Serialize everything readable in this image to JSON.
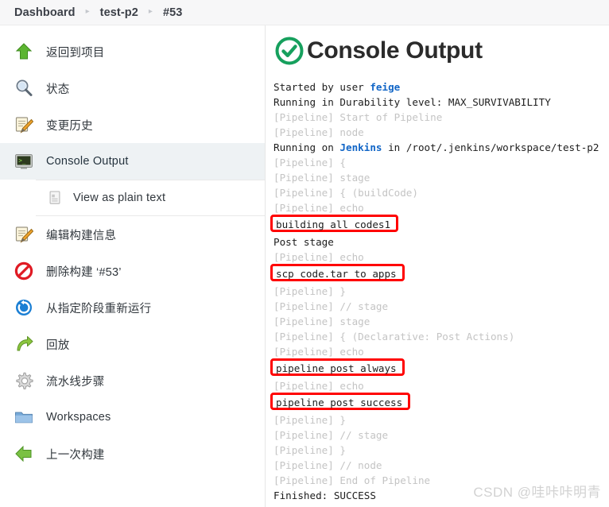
{
  "breadcrumb": {
    "items": [
      {
        "label": "Dashboard",
        "name": "breadcrumb-dashboard"
      },
      {
        "label": "test-p2",
        "name": "breadcrumb-test-p2"
      },
      {
        "label": "#53",
        "name": "breadcrumb-build-53"
      }
    ],
    "separator": "▸"
  },
  "sidebar": {
    "items": [
      {
        "label": "返回到项目",
        "icon": "up-arrow-green-icon",
        "name": "sidebar-item-back-to-project",
        "active": false
      },
      {
        "label": "状态",
        "icon": "magnifier-icon",
        "name": "sidebar-item-status",
        "active": false
      },
      {
        "label": "变更历史",
        "icon": "notepad-pencil-icon",
        "name": "sidebar-item-changes",
        "active": false
      },
      {
        "label": "Console Output",
        "icon": "terminal-icon",
        "name": "sidebar-item-console-output",
        "active": true
      }
    ],
    "sub_item": {
      "label": "View as plain text",
      "icon": "plain-text-icon",
      "name": "sidebar-subitem-view-as-plain-text"
    },
    "items2": [
      {
        "label": "编辑构建信息",
        "icon": "notepad-pencil-icon",
        "name": "sidebar-item-edit-build-information",
        "active": false
      },
      {
        "label": "删除构建 ‘#53’",
        "icon": "no-entry-icon",
        "name": "sidebar-item-delete-build",
        "active": false
      },
      {
        "label": "从指定阶段重新运行",
        "icon": "restart-circle-icon",
        "name": "sidebar-item-restart-from-stage",
        "active": false
      },
      {
        "label": "回放",
        "icon": "replay-arrow-icon",
        "name": "sidebar-item-replay",
        "active": false
      },
      {
        "label": "流水线步骤",
        "icon": "gear-icon",
        "name": "sidebar-item-pipeline-steps",
        "active": false
      },
      {
        "label": "Workspaces",
        "icon": "folder-icon",
        "name": "sidebar-item-workspaces",
        "active": false
      },
      {
        "label": "上一次构建",
        "icon": "left-arrow-green-icon",
        "name": "sidebar-item-previous-build",
        "active": false
      }
    ]
  },
  "console": {
    "title": "Console Output",
    "status_icon": "success-check-circle-icon",
    "status_color": "#16a05d",
    "annotation_color": "#ff0000",
    "pipeline_prefix": "[Pipeline]",
    "lines": [
      {
        "type": "mixed",
        "parts": [
          {
            "t": "Started by user ",
            "s": "plain"
          },
          {
            "t": "feige",
            "s": "link"
          }
        ]
      },
      {
        "type": "plain",
        "text": "Running in Durability level: MAX_SURVIVABILITY"
      },
      {
        "type": "pipeline",
        "text": "[Pipeline] Start of Pipeline"
      },
      {
        "type": "pipeline",
        "text": "[Pipeline] node"
      },
      {
        "type": "mixed",
        "parts": [
          {
            "t": "Running on ",
            "s": "plain"
          },
          {
            "t": "Jenkins",
            "s": "link"
          },
          {
            "t": " in /root/.jenkins/workspace/test-p2",
            "s": "plain"
          }
        ]
      },
      {
        "type": "pipeline",
        "text": "[Pipeline] {"
      },
      {
        "type": "pipeline",
        "text": "[Pipeline] stage"
      },
      {
        "type": "pipeline",
        "text": "[Pipeline] { (buildCode)"
      },
      {
        "type": "pipeline",
        "text": "[Pipeline] echo"
      },
      {
        "type": "boxed",
        "text": "building all codes1"
      },
      {
        "type": "plain",
        "text": "Post stage"
      },
      {
        "type": "pipeline",
        "text": "[Pipeline] echo"
      },
      {
        "type": "boxed",
        "text": "scp code.tar to apps"
      },
      {
        "type": "pipeline",
        "text": "[Pipeline] }"
      },
      {
        "type": "pipeline",
        "text": "[Pipeline] // stage"
      },
      {
        "type": "pipeline",
        "text": "[Pipeline] stage"
      },
      {
        "type": "pipeline",
        "text": "[Pipeline] { (Declarative: Post Actions)"
      },
      {
        "type": "pipeline",
        "text": "[Pipeline] echo"
      },
      {
        "type": "boxed",
        "text": "pipeline post always"
      },
      {
        "type": "pipeline",
        "text": "[Pipeline] echo"
      },
      {
        "type": "boxed",
        "text": "pipeline post success"
      },
      {
        "type": "pipeline",
        "text": "[Pipeline] }"
      },
      {
        "type": "pipeline",
        "text": "[Pipeline] // stage"
      },
      {
        "type": "pipeline",
        "text": "[Pipeline] }"
      },
      {
        "type": "pipeline",
        "text": "[Pipeline] // node"
      },
      {
        "type": "pipeline",
        "text": "[Pipeline] End of Pipeline"
      },
      {
        "type": "plain",
        "text": "Finished: SUCCESS"
      }
    ]
  },
  "watermark": {
    "text": "CSDN @哇咔咔明青"
  }
}
